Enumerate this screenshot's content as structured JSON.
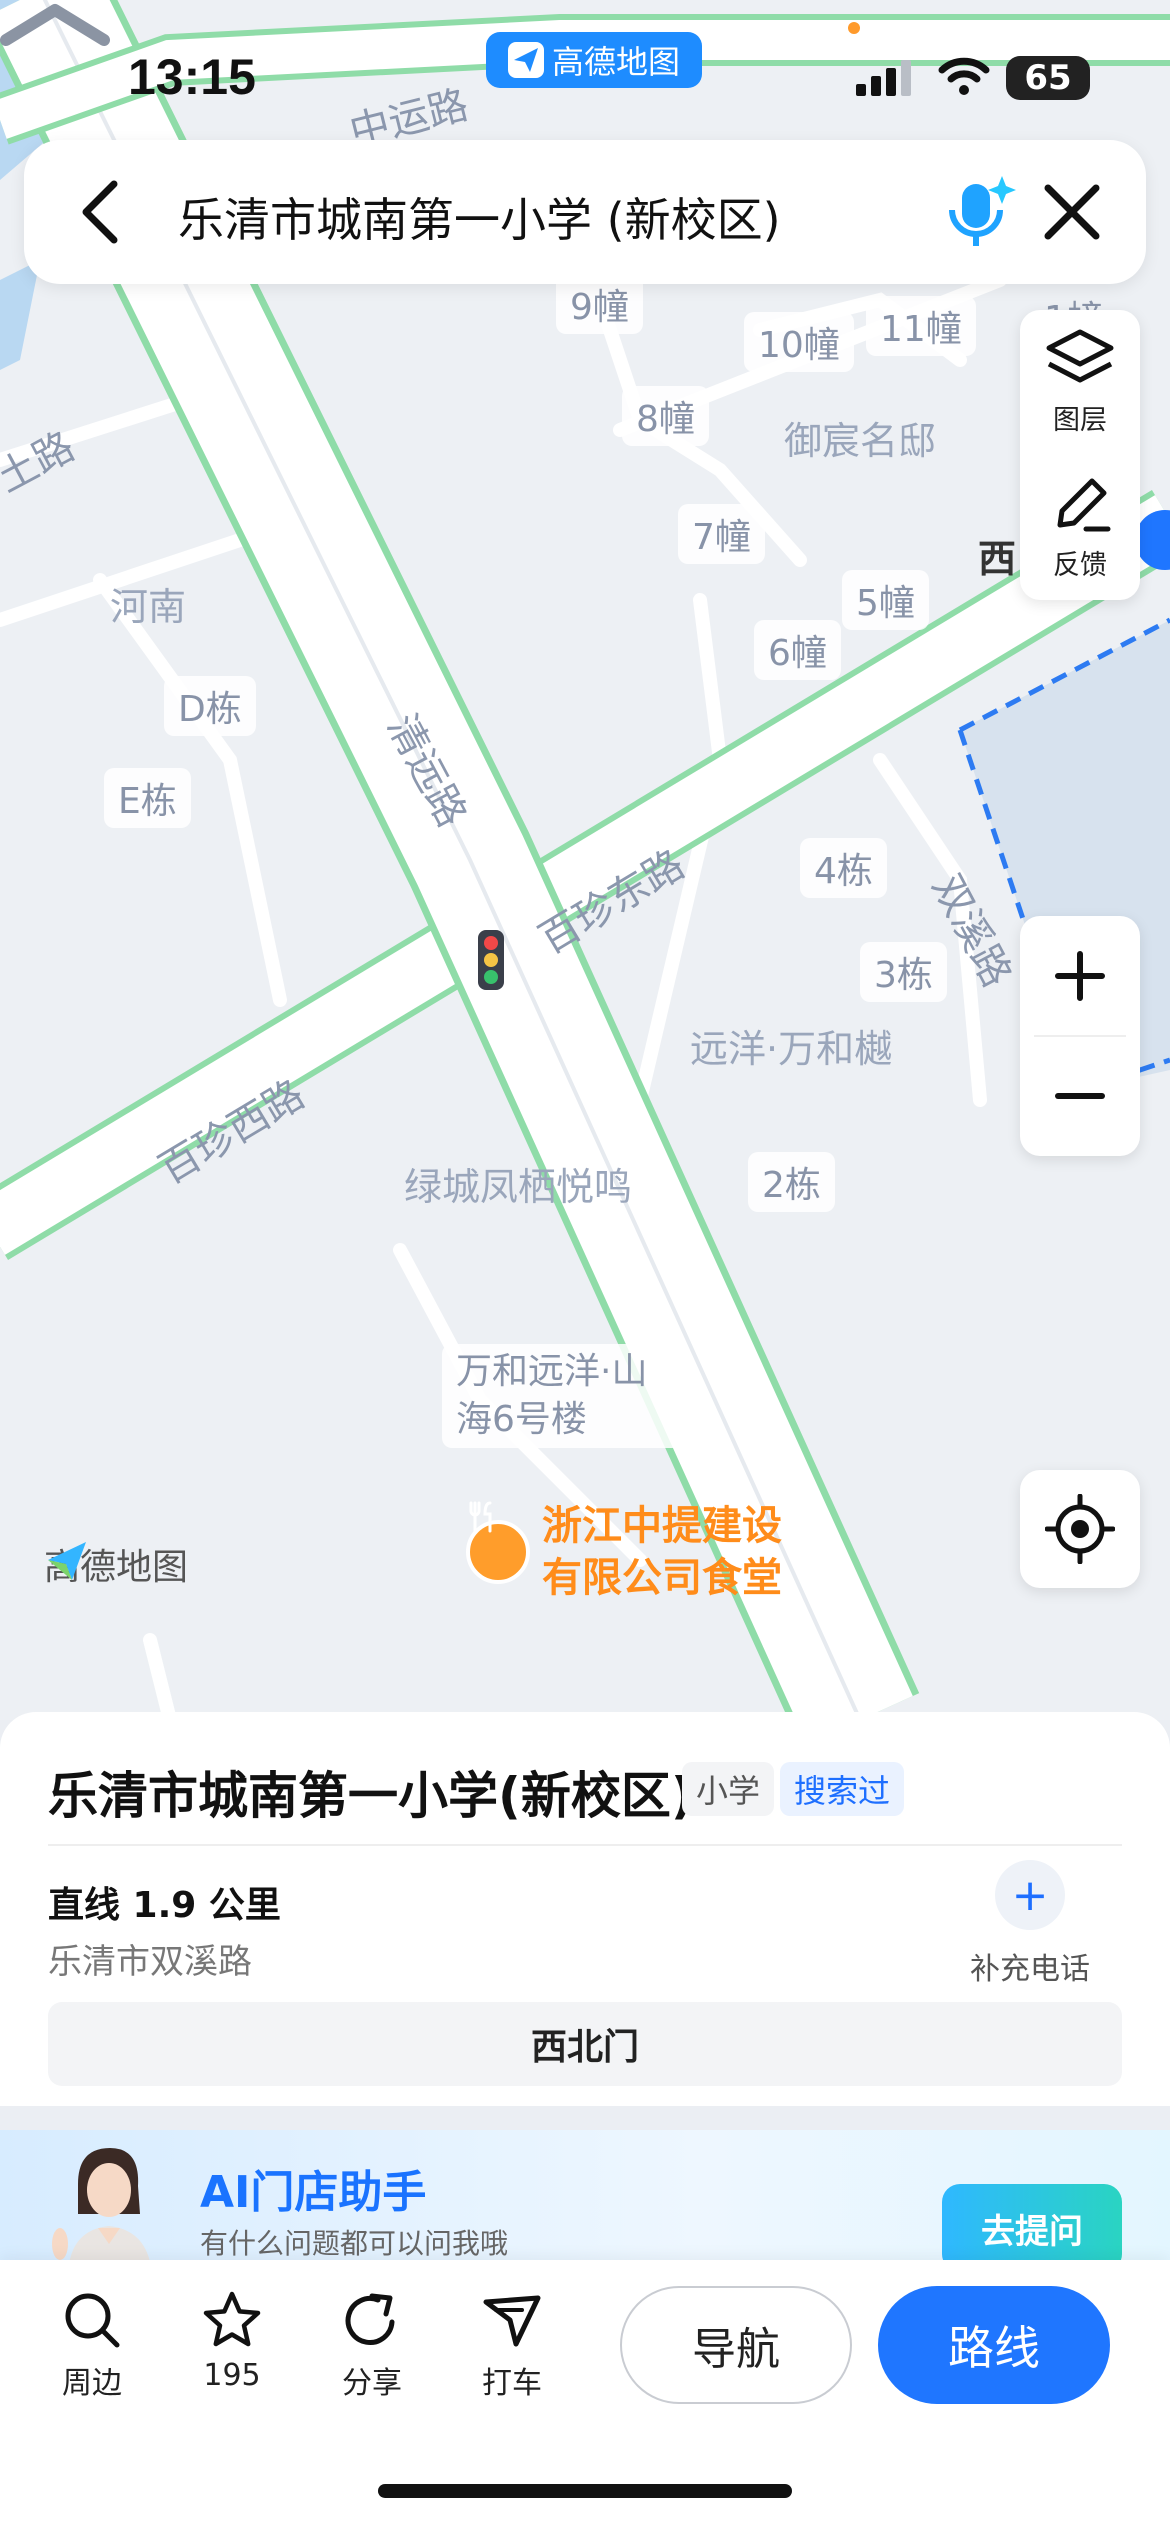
{
  "status_bar": {
    "time": "13:15",
    "app_pill": "高德地图",
    "battery": "65"
  },
  "search": {
    "query": "乐清市城南第一小学 (新校区)"
  },
  "map": {
    "roads": [
      "中运路",
      "清远路",
      "百珍东路",
      "百珍西路",
      "双溪路",
      "土路"
    ],
    "areas": [
      "河南",
      "御宸名邸",
      "远洋·万和樾",
      "绿城凤栖悦鸣",
      "西"
    ],
    "buildings": [
      "9幢",
      "10幢",
      "11幢",
      "8幢",
      "7幢",
      "5幢",
      "6幢",
      "D栋",
      "E栋",
      "4栋",
      "3栋",
      "2栋",
      "1幢"
    ],
    "poi_building": "万和远洋·山海6号楼",
    "poi_food": "浙江中提建设有限公司食堂",
    "logo": "高德地图"
  },
  "controls": {
    "layers": "图层",
    "feedback": "反馈"
  },
  "place": {
    "title": "乐清市城南第一小学(新校区)",
    "category": "小学",
    "searched_tag": "搜索过",
    "distance": "直线 1.9 公里",
    "address": "乐清市双溪路",
    "add_phone": "补充电话",
    "entrance": "西北门"
  },
  "ai_banner": {
    "title": "AI门店助手",
    "subtitle": "有什么问题都可以问我哦",
    "button": "去提问"
  },
  "toolbar": {
    "nearby": "周边",
    "favorite_count": "195",
    "share": "分享",
    "taxi": "打车",
    "navigate": "导航",
    "route": "路线"
  },
  "colors": {
    "accent": "#1f76ff",
    "road_green": "#8fdca8",
    "poi_orange": "#ff8c1a"
  }
}
